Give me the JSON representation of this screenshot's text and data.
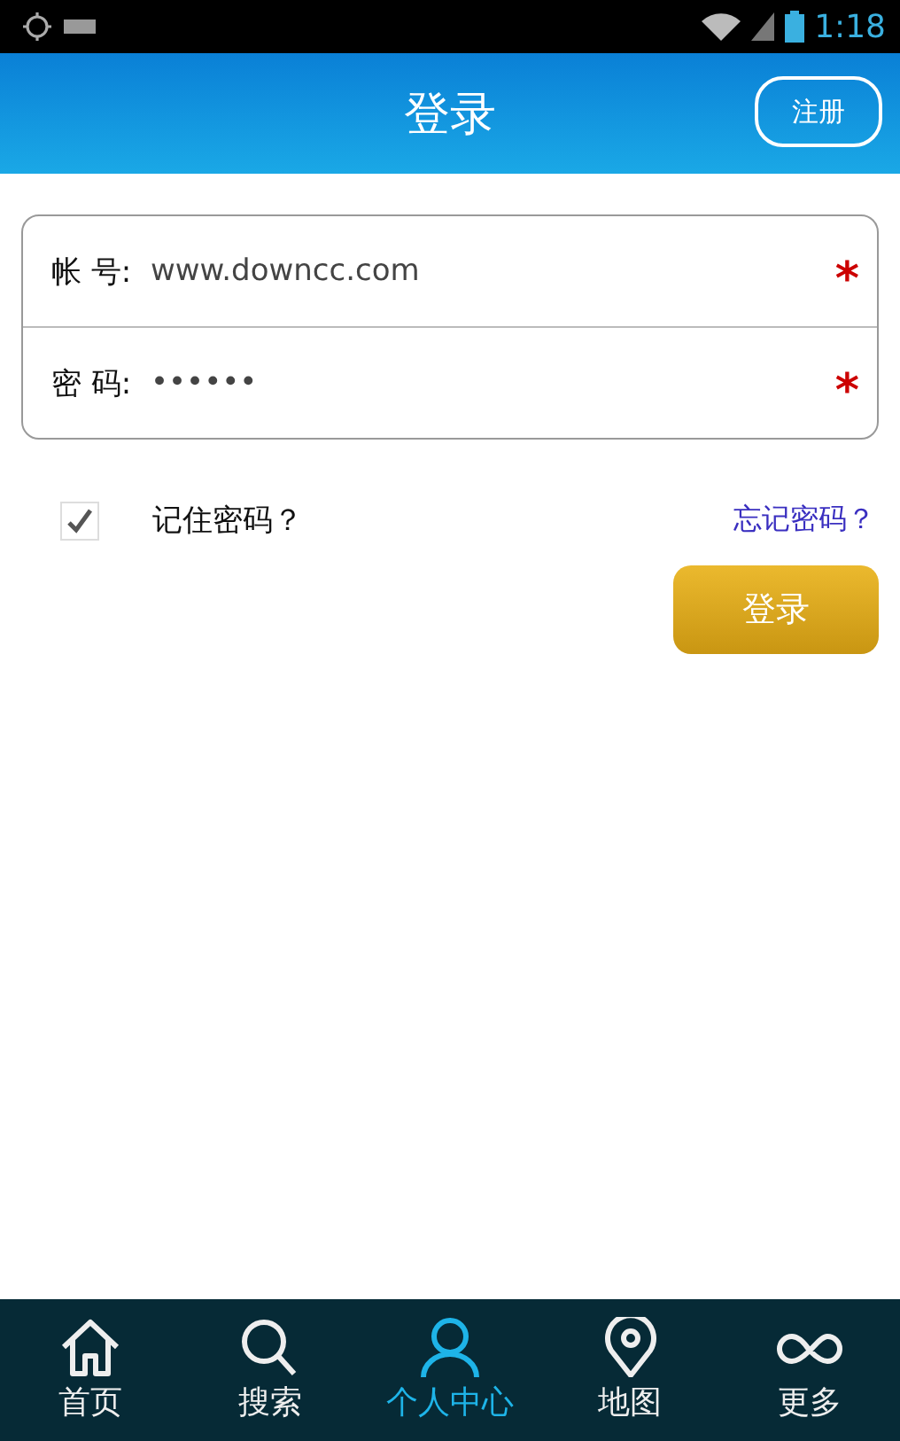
{
  "status_bar": {
    "time": "1:18"
  },
  "header": {
    "title": "登录",
    "register_button": "注册"
  },
  "form": {
    "fields": [
      {
        "label": "帐 号:",
        "value": "www.downcc.com",
        "required": "*"
      },
      {
        "label": "密 码:",
        "value": "••••••",
        "required": "*"
      }
    ]
  },
  "remember": {
    "label": "记住密码？",
    "checked": true
  },
  "forgot_link": "忘记密码？",
  "login_button": "登录",
  "tabs": [
    {
      "label": "首页",
      "selected": false
    },
    {
      "label": "搜索",
      "selected": false
    },
    {
      "label": "个人中心",
      "selected": true
    },
    {
      "label": "地图",
      "selected": false
    },
    {
      "label": "更多",
      "selected": false
    }
  ]
}
